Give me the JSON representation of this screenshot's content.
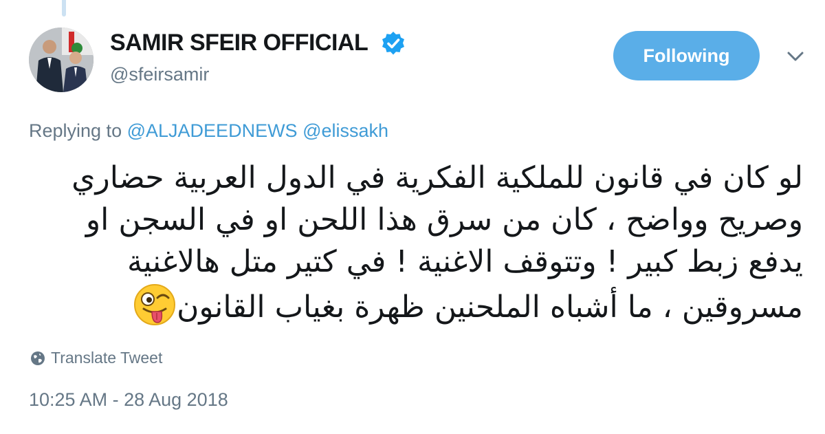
{
  "author": {
    "display_name": "SAMIR SFEIR OFFICIAL",
    "handle": "@sfeirsamir",
    "verified": true,
    "verified_icon": "verified-badge-icon",
    "avatar_icon": "profile-photo"
  },
  "actions": {
    "follow_label": "Following",
    "menu_icon": "chevron-down-icon"
  },
  "reply": {
    "prefix": "Replying to",
    "mentions": [
      "@ALJADEEDNEWS",
      "@elissakh"
    ]
  },
  "tweet": {
    "lines": [
      "لو كان في قانون للملكية الفكرية في الدول العربية حضاري",
      "وصريح وواضح ، كان من سرق هذا اللحن او في السجن او",
      "يدفع زبط كبير ! وتتوقف الاغنية ! في كتير متل هالاغنية",
      "مسروقين ، ما أشباه الملحنين ظهرة بغياب القانون"
    ],
    "emoji": "winking-face-with-tongue-icon"
  },
  "translate": {
    "label": "Translate Tweet",
    "icon": "globe-icon"
  },
  "timestamp": "10:25 AM - 28 Aug 2018",
  "colors": {
    "accent": "#5aaee8",
    "link": "#3f9bd6",
    "muted": "#657786",
    "text": "#14171a",
    "verified": "#1da1f2"
  }
}
